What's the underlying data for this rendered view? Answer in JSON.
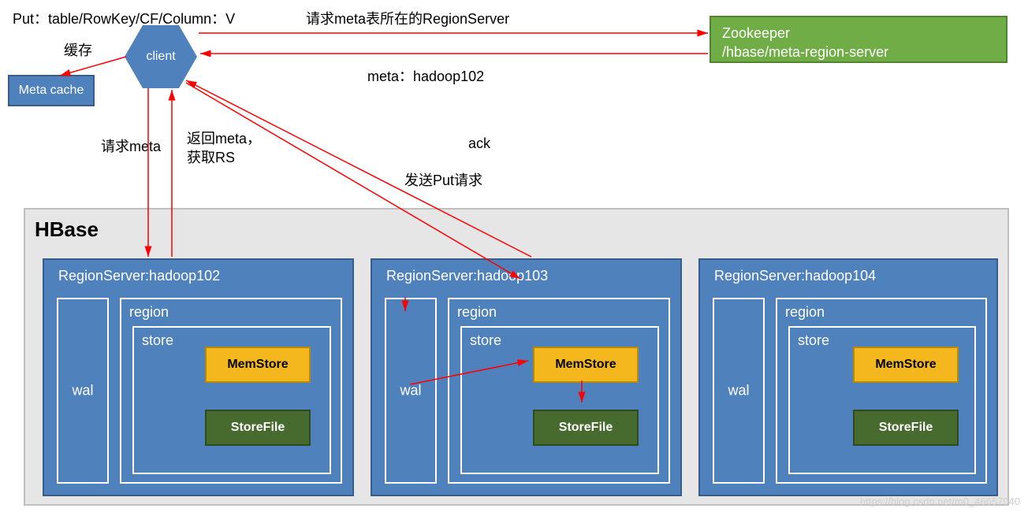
{
  "topLeftText": "Put：table/RowKey/CF/Column：V",
  "cacheLabel": "缓存",
  "metaCacheBox": "Meta cache",
  "clientBox": "client",
  "reqMetaRSLabel": "请求meta表所在的RegionServer",
  "zookeeper": {
    "line1": "Zookeeper",
    "line2": "/hbase/meta-region-server"
  },
  "metaHadoopLabel": "meta：hadoop102",
  "reqMetaLabel": "请求meta",
  "returnMeta": {
    "line1": "返回meta，",
    "line2": "获取RS"
  },
  "ackLabel": "ack",
  "sendPutLabel": "发送Put请求",
  "hbaseTitle": "HBase",
  "regionServers": [
    {
      "title": "RegionServer:hadoop102",
      "wal": "wal",
      "region": "region",
      "store": "store",
      "memstore": "MemStore",
      "storefile": "StoreFile"
    },
    {
      "title": "RegionServer:hadoop103",
      "wal": "wal",
      "region": "region",
      "store": "store",
      "memstore": "MemStore",
      "storefile": "StoreFile"
    },
    {
      "title": "RegionServer:hadoop104",
      "wal": "wal",
      "region": "region",
      "store": "store",
      "memstore": "MemStore",
      "storefile": "StoreFile"
    }
  ],
  "watermark": "https://blog.csdn.net/m0_46657040"
}
